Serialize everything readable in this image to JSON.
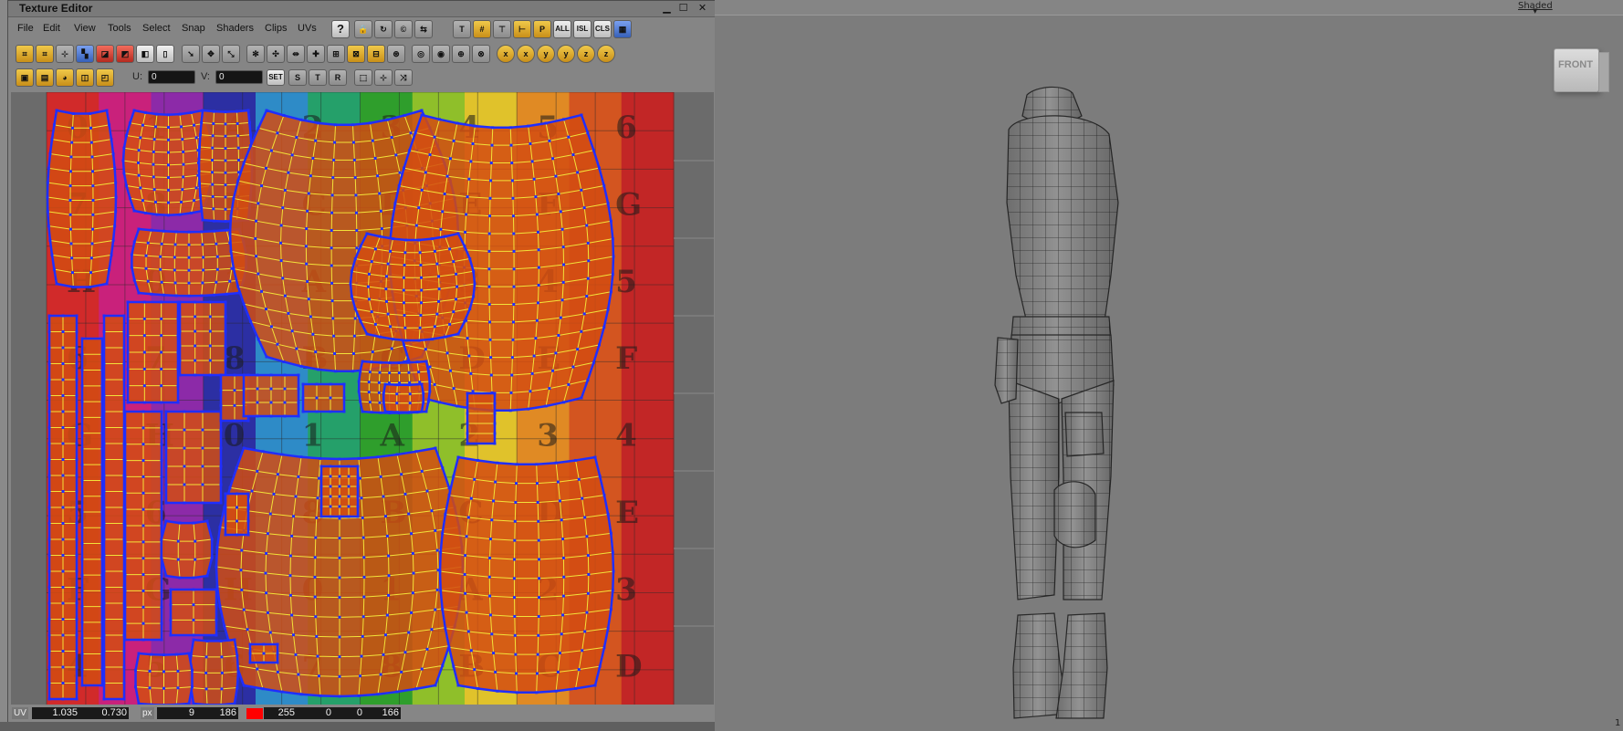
{
  "texture_editor": {
    "title": "Texture Editor",
    "menu": [
      "File",
      "Edit",
      "View",
      "Tools",
      "Select",
      "Snap",
      "Shaders",
      "Clips",
      "UVs"
    ],
    "toolbar_text_buttons": {
      "all": "ALL",
      "isl": "ISL",
      "cls": "CLS",
      "set": "SET"
    },
    "u_label": "U:",
    "u_value": "0",
    "v_label": "V:",
    "v_value": "0",
    "status": {
      "uv_label": "UV",
      "u": "1.035",
      "v": "0.730",
      "px_label": "px",
      "px_x": "9",
      "px_y": "186",
      "color_swatch": "#ff0000",
      "r": "255",
      "g": "0",
      "b": "0",
      "a": "166"
    }
  },
  "viewport": {
    "mode": "Shaded",
    "viewcube_label": "FRONT",
    "corner_number": "1"
  },
  "checker_labels": [
    "0",
    "1",
    "A",
    "2",
    "3",
    "4",
    "5",
    "6",
    "7",
    "8",
    "B",
    "C",
    "D",
    "E",
    "F",
    "G",
    "H"
  ],
  "checker_colors": [
    "#d12a2a",
    "#c9217b",
    "#8c2aa8",
    "#2c2fa3",
    "#2e8bc7",
    "#25a06a",
    "#2f9e2c",
    "#8fbf2a",
    "#e0c22b",
    "#e08a24",
    "#d35520",
    "#c22626"
  ],
  "colors": {
    "uv_shell": "#d24c12",
    "uv_edge": "#f2e23a",
    "uv_vertex": "#1f2eff",
    "model_fill": "#8f8f8f",
    "model_line": "#2b2b2b"
  }
}
